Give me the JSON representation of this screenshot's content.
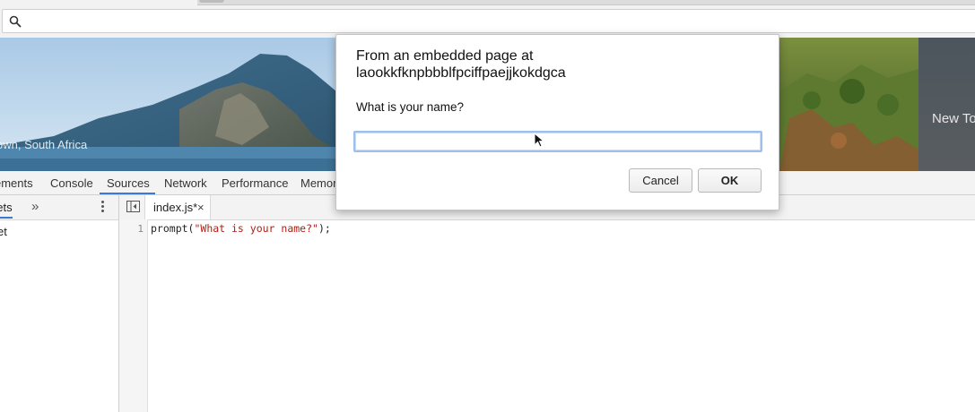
{
  "omnibox": {
    "value": "",
    "icon": "search-icon"
  },
  "banner": {
    "caption": "own, South Africa",
    "new_tab_text": "New To",
    "colors": {
      "sky": "#b9d4ec",
      "mountain": "#4d7a9a",
      "sea": "#5a8fb5",
      "greenery": "#5b7a36"
    }
  },
  "devtools": {
    "tabs": [
      "ements",
      "Console",
      "Sources",
      "Network",
      "Performance",
      "Memory"
    ],
    "active_tab": "Sources",
    "accent": "#3879d9",
    "navigator": {
      "tab_label": "pets",
      "more_icon": "chevron-double-right-icon",
      "menu_icon": "kebab-menu-icon",
      "items": [
        "et"
      ]
    },
    "editor": {
      "file_tab": {
        "name": "index.js*",
        "close": "×"
      },
      "lines": [
        {
          "number": "1",
          "code_before": "prompt(",
          "string": "\"What is your name?\"",
          "code_after": ");"
        }
      ]
    }
  },
  "dialog": {
    "title_line1": "From an embedded page at",
    "title_line2": "laookkfknpbbblfpciffpaejjkokdgca",
    "message": "What is your name?",
    "input_value": "",
    "cancel_label": "Cancel",
    "ok_label": "OK",
    "focus_color": "#9cbfee"
  }
}
